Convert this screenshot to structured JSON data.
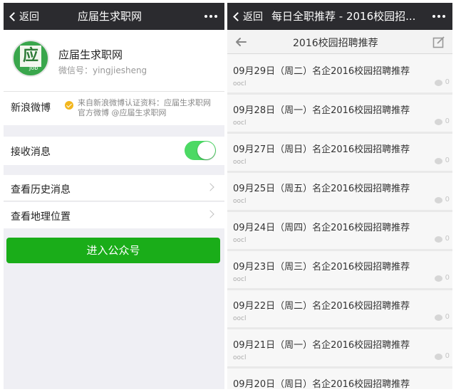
{
  "left": {
    "navbar": {
      "back_label": "返回",
      "title": "应届生求职网"
    },
    "profile": {
      "avatar_glyph": "应",
      "avatar_tag": "Job",
      "name": "应届生求职网",
      "wechat_id": "微信号：yingjiesheng"
    },
    "weibo": {
      "label": "新浪微博",
      "description": "来自新浪微博认证资料：应届生求职网官方微博 @应届生求职网"
    },
    "receive": {
      "label": "接收消息",
      "enabled": true
    },
    "history": {
      "label": "查看历史消息"
    },
    "location": {
      "label": "查看地理位置"
    },
    "enter_button": "进入公众号"
  },
  "right": {
    "navbar": {
      "back_label": "返回",
      "title": "每日全职推荐 - 2016校园招..."
    },
    "subbar": {
      "title": "2016校园招聘推荐"
    },
    "items": [
      {
        "title": "09月29日（周二）名企2016校园招聘推荐",
        "source": "oocl",
        "comments": "0"
      },
      {
        "title": "09月28日（周一）名企2016校园招聘推荐",
        "source": "oocl",
        "comments": "0"
      },
      {
        "title": "09月27日（周日）名企2016校园招聘推荐",
        "source": "oocl",
        "comments": "0"
      },
      {
        "title": "09月25日（周五）名企2016校园招聘推荐",
        "source": "oocl",
        "comments": "0"
      },
      {
        "title": "09月24日（周四）名企2016校园招聘推荐",
        "source": "oocl",
        "comments": "0"
      },
      {
        "title": "09月23日（周三）名企2016校园招聘推荐",
        "source": "oocl",
        "comments": "0"
      },
      {
        "title": "09月22日（周二）名企2016校园招聘推荐",
        "source": "oocl",
        "comments": "0"
      },
      {
        "title": "09月21日（周一）名企2016校园招聘推荐",
        "source": "oocl",
        "comments": "0"
      },
      {
        "title": "09月20日（周日）名企2016校园招聘推荐",
        "source": "",
        "comments": ""
      }
    ]
  },
  "colors": {
    "navbar": "#2b2b2f",
    "accent_green": "#1aad19",
    "toggle_on": "#4cd964",
    "verify_badge": "#f2b61e"
  },
  "icons": [
    "back-chevron-icon",
    "more-dots-icon",
    "verified-icon",
    "chevron-right-icon",
    "back-arrow-icon",
    "compose-icon",
    "comment-icon"
  ]
}
